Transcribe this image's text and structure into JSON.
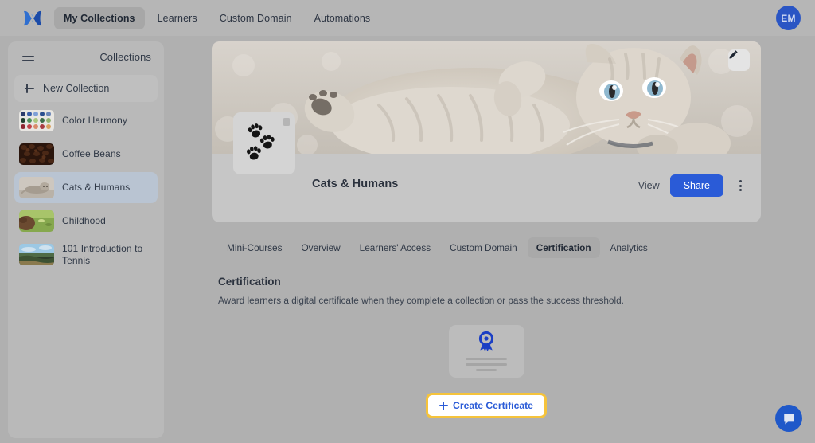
{
  "topnav": {
    "logo_icon": "brand-logo-icon",
    "items": [
      {
        "label": "My Collections",
        "active": true
      },
      {
        "label": "Learners",
        "active": false
      },
      {
        "label": "Custom Domain",
        "active": false
      },
      {
        "label": "Automations",
        "active": false
      }
    ],
    "avatar_initials": "EM",
    "avatar_color": "#2a55c4"
  },
  "sidebar": {
    "menu_icon": "hamburger-menu-icon",
    "title": "Collections",
    "new_collection_label": "New Collection",
    "new_collection_icon": "plus-icon",
    "items": [
      {
        "label": "Color Harmony",
        "thumb": "color-swatch-grid",
        "selected": false
      },
      {
        "label": "Coffee Beans",
        "thumb": "coffee-beans",
        "selected": false
      },
      {
        "label": "Cats & Humans",
        "thumb": "cat-lying",
        "selected": true
      },
      {
        "label": "Childhood",
        "thumb": "child-field",
        "selected": false
      },
      {
        "label": "101 Introduction to Tennis",
        "thumb": "tennis-landscape",
        "selected": false
      }
    ]
  },
  "collection": {
    "banner_image": "kitten-lying-on-back",
    "edit_icon": "pencil-icon",
    "thumbnail_icon": "paw-prints-icon",
    "title": "Cats & Humans",
    "view_label": "View",
    "share_label": "Share",
    "share_color": "#2a5bd7",
    "more_icon": "kebab-menu-icon"
  },
  "tabs": [
    {
      "label": "Mini-Courses",
      "active": false
    },
    {
      "label": "Overview",
      "active": false
    },
    {
      "label": "Learners' Access",
      "active": false
    },
    {
      "label": "Custom Domain",
      "active": false
    },
    {
      "label": "Certification",
      "active": true
    },
    {
      "label": "Analytics",
      "active": false
    }
  ],
  "certification": {
    "heading": "Certification",
    "description": "Award learners a digital certificate when they complete a collection or pass the success threshold.",
    "placeholder_icon": "award-ribbon-icon",
    "create_label": "Create Certificate",
    "create_icon": "plus-icon",
    "highlight_color": "#f5c33b",
    "link_color": "#2a5bd7"
  },
  "chat": {
    "icon": "chat-bubble-icon",
    "color": "#1f58c9"
  }
}
